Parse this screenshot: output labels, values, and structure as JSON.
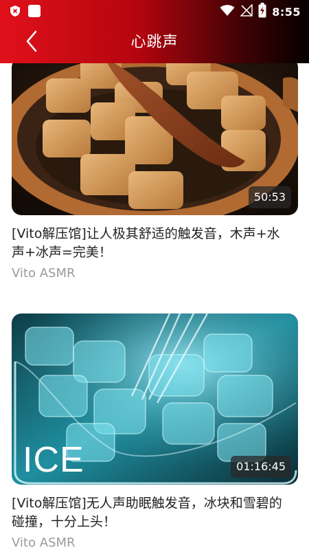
{
  "status_bar": {
    "time": "8:55",
    "left_icons": [
      "shield-icon",
      "square-icon"
    ],
    "right_icons": [
      "wifi-icon",
      "signal-off-icon",
      "battery-charging-icon"
    ]
  },
  "app_bar": {
    "title": "心跳声",
    "back_icon": "chevron-left-icon"
  },
  "videos": [
    {
      "title": "[Vito解压馆]让人极其舒适的触发音，木声+水声+冰声=完美！",
      "author": "Vito ASMR",
      "duration": "50:53"
    },
    {
      "title": "[Vito解压馆]无人声助眠触发音，冰块和雪碧的碰撞，十分上头！",
      "author": "Vito ASMR",
      "duration": "01:16:45",
      "overlay_text": "ICE"
    }
  ],
  "colors": {
    "header_start": "#e0101b",
    "header_end": "#050000",
    "author_gray": "#9a9a9a"
  }
}
